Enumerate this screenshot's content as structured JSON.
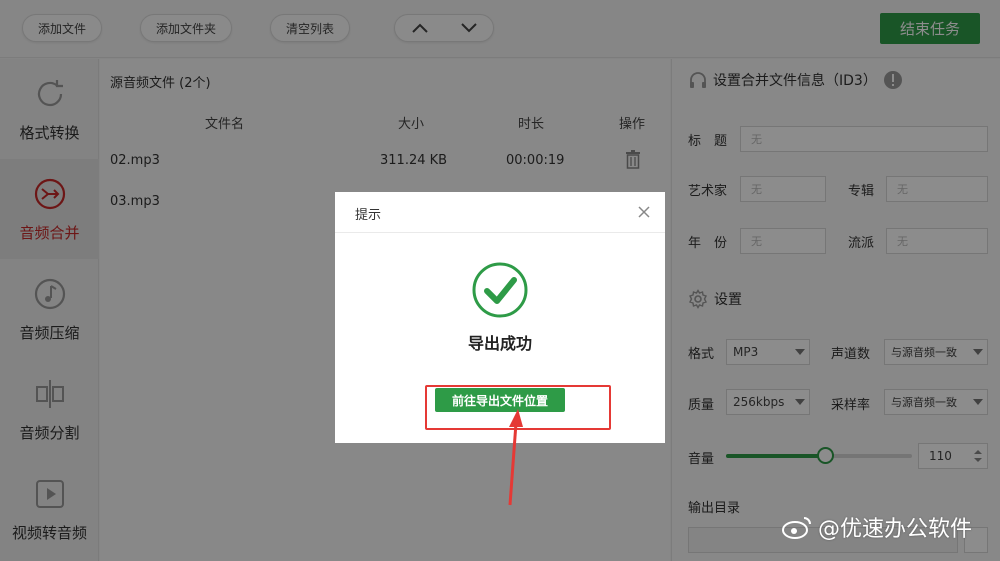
{
  "toolbar": {
    "add_file": "添加文件",
    "add_folder": "添加文件夹",
    "clear_list": "清空列表",
    "end_task": "结束任务"
  },
  "sidebar": {
    "items": [
      {
        "label": "格式转换",
        "icon": "refresh-icon"
      },
      {
        "label": "音频合并",
        "icon": "merge-icon",
        "active": true
      },
      {
        "label": "音频压缩",
        "icon": "music-note-icon"
      },
      {
        "label": "音频分割",
        "icon": "split-icon"
      },
      {
        "label": "视频转音频",
        "icon": "video-play-icon"
      }
    ]
  },
  "file_list": {
    "title": "源音频文件 (2个)",
    "columns": {
      "name": "文件名",
      "size": "大小",
      "duration": "时长",
      "action": "操作"
    },
    "rows": [
      {
        "name": "02.mp3",
        "size": "311.24 KB",
        "duration": "00:00:19"
      },
      {
        "name": "03.mp3",
        "size": "",
        "duration": ""
      }
    ]
  },
  "id3": {
    "title": "设置合并文件信息（ID3）",
    "title_label": "标　题",
    "artist_label": "艺术家",
    "album_label": "专辑",
    "year_label": "年　份",
    "genre_label": "流派",
    "placeholder": "无"
  },
  "settings": {
    "title": "设置",
    "format_label": "格式",
    "format_value": "MP3",
    "channels_label": "声道数",
    "channels_value": "与源音频一致",
    "quality_label": "质量",
    "quality_value": "256kbps",
    "samplerate_label": "采样率",
    "samplerate_value": "与源音频一致",
    "volume_label": "音量",
    "volume_value": "110",
    "volume_fraction": 0.54,
    "output_label": "输出目录"
  },
  "dialog": {
    "title": "提示",
    "message": "导出成功",
    "button": "前往导出文件位置"
  },
  "watermark": "@优速办公软件",
  "colors": {
    "accent": "#2e9b47",
    "highlight": "#e53935",
    "active_text": "#c62828"
  }
}
